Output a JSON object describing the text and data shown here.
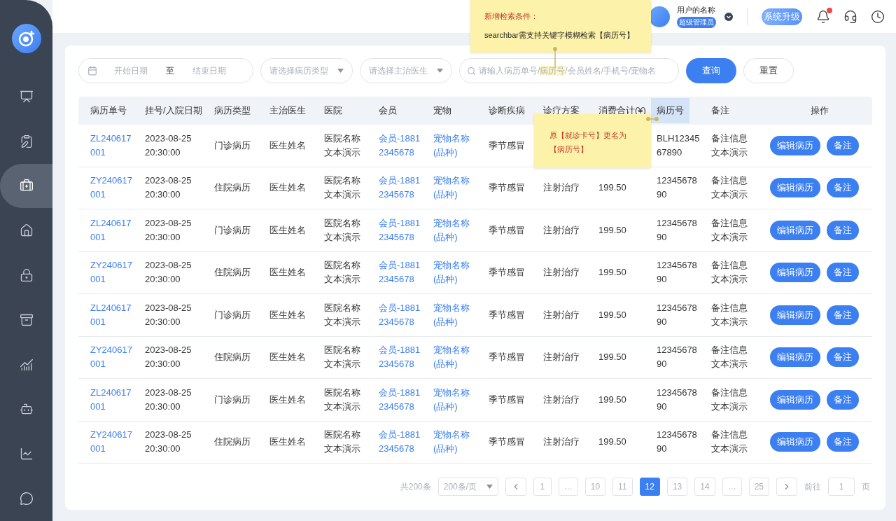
{
  "sidebar": {
    "items": [
      {
        "selected": false
      },
      {
        "selected": false
      },
      {
        "selected": true
      },
      {
        "selected": false
      },
      {
        "selected": false
      },
      {
        "selected": false
      },
      {
        "selected": false
      },
      {
        "selected": false
      },
      {
        "selected": false
      },
      {
        "selected": false
      }
    ]
  },
  "header": {
    "user_name": "用户的名称",
    "role": "超级管理员",
    "upgrade_button": "系统升级",
    "has_notification": true
  },
  "notes": [
    {
      "title": "新增检索条件：",
      "text": "searchbar需支持关键字模糊检索【病历号】"
    },
    {
      "text": "原【就诊卡号】更名为【病历号】"
    }
  ],
  "filters": {
    "date_start_placeholder": "开始日期",
    "date_separator": "至",
    "date_end_placeholder": "结束日期",
    "record_type_placeholder": "请选择病历类型",
    "doctor_placeholder": "请选择主治医生",
    "search_parts": [
      {
        "text": "请输入病历单号/",
        "highlighted": false
      },
      {
        "text": "病历号",
        "highlighted": true
      },
      {
        "text": "/会员姓名/手机号/宠物名",
        "highlighted": false
      }
    ],
    "query_button": "查询",
    "reset_button": "重置"
  },
  "table": {
    "columns": [
      {
        "label": "病历单号",
        "highlighted": false
      },
      {
        "label": "挂号/入院日期",
        "highlighted": false
      },
      {
        "label": "病历类型",
        "highlighted": false
      },
      {
        "label": "主治医生",
        "highlighted": false
      },
      {
        "label": "医院",
        "highlighted": false
      },
      {
        "label": "会员",
        "highlighted": false
      },
      {
        "label": "宠物",
        "highlighted": false
      },
      {
        "label": "诊断疾病",
        "highlighted": false
      },
      {
        "label": "诊疗方案",
        "highlighted": false
      },
      {
        "label": "消费合计(¥)",
        "highlighted": false
      },
      {
        "label": "病历号",
        "highlighted": true
      },
      {
        "label": "备注",
        "highlighted": false
      },
      {
        "label": "操作",
        "highlighted": false
      }
    ],
    "rows": [
      {
        "id": "ZL240617001",
        "date": "2023-08-25 20:30:00",
        "type": "门诊病历",
        "doctor": "医生姓名",
        "hospital": "医院名称文本演示",
        "member": "会员-18812345678",
        "pet": "宠物名称(品种)",
        "diagnosis": "季节感冒",
        "record_no": "BLH1234567890",
        "remark": "备注信息文本演示",
        "edit_button": "编辑病历",
        "note_button": "备注"
      },
      {
        "id": "ZY240617001",
        "date": "2023-08-25 20:30:00",
        "type": "住院病历",
        "doctor": "医生姓名",
        "hospital": "医院名称文本演示",
        "member": "会员-18812345678",
        "pet": "宠物名称(品种)",
        "diagnosis": "季节感冒",
        "treatment": "注射治疗",
        "cost": "199.50",
        "record_no": "1234567890",
        "remark": "备注信息文本演示",
        "edit_button": "编辑病历",
        "note_button": "备注"
      },
      {
        "id": "ZL240617001",
        "date": "2023-08-25 20:30:00",
        "type": "门诊病历",
        "doctor": "医生姓名",
        "hospital": "医院名称文本演示",
        "member": "会员-18812345678",
        "pet": "宠物名称(品种)",
        "diagnosis": "季节感冒",
        "treatment": "注射治疗",
        "cost": "199.50",
        "record_no": "1234567890",
        "remark": "备注信息文本演示",
        "edit_button": "编辑病历",
        "note_button": "备注"
      },
      {
        "id": "ZY240617001",
        "date": "2023-08-25 20:30:00",
        "type": "住院病历",
        "doctor": "医生姓名",
        "hospital": "医院名称文本演示",
        "member": "会员-18812345678",
        "pet": "宠物名称(品种)",
        "diagnosis": "季节感冒",
        "treatment": "注射治疗",
        "cost": "199.50",
        "record_no": "1234567890",
        "remark": "备注信息文本演示",
        "edit_button": "编辑病历",
        "note_button": "备注"
      },
      {
        "id": "ZL240617001",
        "date": "2023-08-25 20:30:00",
        "type": "门诊病历",
        "doctor": "医生姓名",
        "hospital": "医院名称文本演示",
        "member": "会员-18812345678",
        "pet": "宠物名称(品种)",
        "diagnosis": "季节感冒",
        "treatment": "注射治疗",
        "cost": "199.50",
        "record_no": "1234567890",
        "remark": "备注信息文本演示",
        "edit_button": "编辑病历",
        "note_button": "备注"
      },
      {
        "id": "ZY240617001",
        "date": "2023-08-25 20:30:00",
        "type": "住院病历",
        "doctor": "医生姓名",
        "hospital": "医院名称文本演示",
        "member": "会员-18812345678",
        "pet": "宠物名称(品种)",
        "diagnosis": "季节感冒",
        "treatment": "注射治疗",
        "cost": "199.50",
        "record_no": "1234567890",
        "remark": "备注信息文本演示",
        "edit_button": "编辑病历",
        "note_button": "备注"
      },
      {
        "id": "ZL240617001",
        "date": "2023-08-25 20:30:00",
        "type": "门诊病历",
        "doctor": "医生姓名",
        "hospital": "医院名称文本演示",
        "member": "会员-18812345678",
        "pet": "宠物名称(品种)",
        "diagnosis": "季节感冒",
        "treatment": "注射治疗",
        "cost": "199.50",
        "record_no": "1234567890",
        "remark": "备注信息文本演示",
        "edit_button": "编辑病历",
        "note_button": "备注"
      },
      {
        "id": "ZY240617001",
        "date": "2023-08-25 20:30:00",
        "type": "住院病历",
        "doctor": "医生姓名",
        "hospital": "医院名称文本演示",
        "member": "会员-18812345678",
        "pet": "宠物名称(品种)",
        "diagnosis": "季节感冒",
        "treatment": "注射治疗",
        "cost": "199.50",
        "record_no": "1234567890",
        "remark": "备注信息文本演示",
        "edit_button": "编辑病历",
        "note_button": "备注"
      }
    ]
  },
  "pagination": {
    "total": "共200条",
    "page_size": "200条/页",
    "pages": [
      {
        "label": "1",
        "selected": false
      },
      {
        "label": "…",
        "selected": false
      },
      {
        "label": "10",
        "selected": false
      },
      {
        "label": "11",
        "selected": false
      },
      {
        "label": "12",
        "selected": true
      },
      {
        "label": "13",
        "selected": false
      },
      {
        "label": "14",
        "selected": false
      },
      {
        "label": "…",
        "selected": false
      },
      {
        "label": "25",
        "selected": false
      }
    ],
    "goto_label": "前往",
    "goto_value": "1",
    "page_suffix": "页"
  }
}
